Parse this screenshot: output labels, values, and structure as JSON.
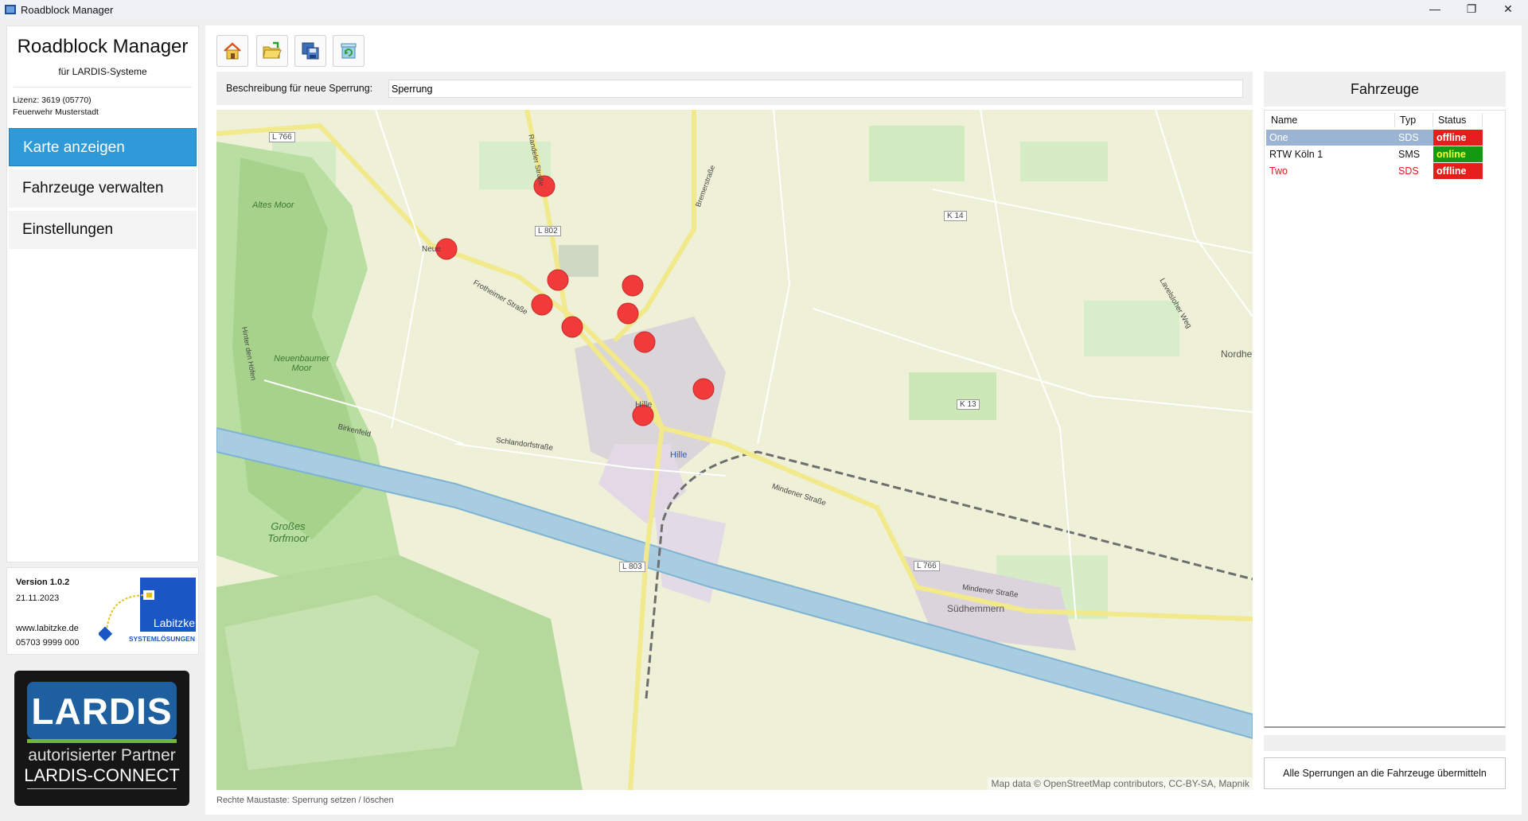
{
  "window": {
    "title": "Roadblock Manager",
    "min": "—",
    "restore": "❐",
    "close": "✕"
  },
  "sidebar": {
    "title": "Roadblock Manager",
    "subtitle": "für LARDIS-Systeme",
    "license_line1": "Lizenz: 3619 (05770)",
    "license_line2": "Feuerwehr Musterstadt",
    "nav": [
      {
        "label": "Karte anzeigen",
        "active": true
      },
      {
        "label": "Fahrzeuge verwalten",
        "active": false
      },
      {
        "label": "Einstellungen",
        "active": false
      }
    ]
  },
  "versionbox": {
    "version": "Version 1.0.2",
    "date": "21.11.2023",
    "website": "www.labitzke.de",
    "phone": "05703 9999 000",
    "logo_name": "Labitzke",
    "logo_sub": "SYSTEMLÖSUNGEN"
  },
  "lardis": {
    "logo": "LARDIS",
    "partner": "autorisierter Partner",
    "connect": "LARDIS-CONNECT"
  },
  "toolbar": {
    "icons": [
      "home-icon",
      "open-folder-icon",
      "save-icon",
      "refresh-icon"
    ]
  },
  "description": {
    "label": "Beschreibung für neue Sperrung:",
    "value": "Sperrung"
  },
  "map": {
    "attribution": "Map data © OpenStreetMap contributors, CC-BY-SA, Mapnik",
    "labels": [
      {
        "text": "L 766"
      },
      {
        "text": "Altes Moor"
      },
      {
        "text": "Neuenbaumer Moor"
      },
      {
        "text": "L 802"
      },
      {
        "text": "K 14"
      },
      {
        "text": "K 13"
      },
      {
        "text": "Hille"
      },
      {
        "text": "Hille"
      },
      {
        "text": "L 803"
      },
      {
        "text": "Großes Torfmoor"
      },
      {
        "text": "L 766"
      },
      {
        "text": "Südhemmern"
      },
      {
        "text": "Nordhe"
      },
      {
        "text": "Frotheimer Straße"
      },
      {
        "text": "Mindener Straße"
      },
      {
        "text": "Schlandorfstraße"
      },
      {
        "text": "Birkenfeld"
      },
      {
        "text": "Mindener Straße"
      },
      {
        "text": "Lavelsloher Weg"
      },
      {
        "text": "Neue"
      },
      {
        "text": "Randeler Straße"
      },
      {
        "text": "Bremerstraße"
      },
      {
        "text": "Hinter den Höfen"
      }
    ],
    "marker_color": "#f13b3b",
    "roadblock_count": 10
  },
  "hint": "Rechte Maustaste: Sperrung setzen / löschen",
  "vehicles": {
    "title": "Fahrzeuge",
    "columns": [
      "Name",
      "Typ",
      "Status"
    ],
    "rows": [
      {
        "name": "One",
        "type": "SDS",
        "status": "offline",
        "selected": true
      },
      {
        "name": "RTW Köln 1",
        "type": "SMS",
        "status": "online",
        "selected": false
      },
      {
        "name": "Two",
        "type": "SDS",
        "status": "offline",
        "selected": false
      }
    ],
    "send_button": "Alle Sperrungen an die Fahrzeuge übermitteln"
  },
  "colors": {
    "accent": "#2e9ad8",
    "offline": "#e91c1c",
    "online": "#149a12",
    "selected_row": "#9bb4d4"
  }
}
